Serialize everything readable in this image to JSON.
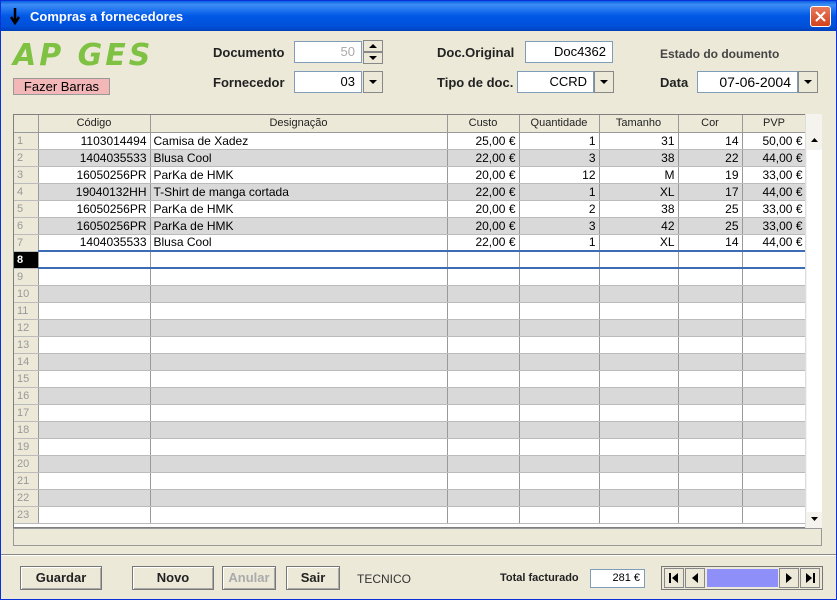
{
  "window": {
    "title": "Compras a fornecedores"
  },
  "header": {
    "logo_text": "AP GES",
    "bars_button": "Fazer Barras",
    "documento_label": "Documento",
    "documento_value": "50",
    "fornecedor_label": "Fornecedor",
    "fornecedor_value": "03",
    "doc_original_label": "Doc.Original",
    "doc_original_value": "Doc4362",
    "tipo_doc_label": "Tipo de doc.",
    "tipo_doc_value": "CCRD",
    "estado_label": "Estado do doumento",
    "data_label": "Data",
    "data_value": "07-06-2004"
  },
  "grid": {
    "columns": [
      "Código",
      "Designação",
      "Custo",
      "Quantidade",
      "Tamanho",
      "Cor",
      "PVP"
    ],
    "rows": [
      [
        "1103014494",
        "Camisa de Xadez",
        "25,00 €",
        "1",
        "31",
        "14",
        "50,00 €"
      ],
      [
        "1404035533",
        "Blusa Cool",
        "22,00 €",
        "3",
        "38",
        "22",
        "44,00 €"
      ],
      [
        "16050256PR",
        "ParKa de HMK",
        "20,00 €",
        "12",
        "M",
        "19",
        "33,00 €"
      ],
      [
        "19040132HH",
        "T-Shirt de manga cortada",
        "22,00 €",
        "1",
        "XL",
        "17",
        "44,00 €"
      ],
      [
        "16050256PR",
        "ParKa de HMK",
        "20,00 €",
        "2",
        "38",
        "25",
        "33,00 €"
      ],
      [
        "16050256PR",
        "ParKa de HMK",
        "20,00 €",
        "3",
        "42",
        "25",
        "33,00 €"
      ],
      [
        "1404035533",
        "Blusa Cool",
        "22,00 €",
        "1",
        "XL",
        "14",
        "44,00 €"
      ]
    ],
    "row_numbers": [
      "1",
      "2",
      "3",
      "4",
      "5",
      "6",
      "7",
      "8",
      "9",
      "10",
      "11",
      "12",
      "13",
      "14",
      "15",
      "16",
      "17",
      "18",
      "19",
      "20",
      "21",
      "22",
      "23"
    ],
    "active_row": "8"
  },
  "footer": {
    "guardar": "Guardar",
    "novo": "Novo",
    "anular": "Anular",
    "sair": "Sair",
    "user": "TECNICO",
    "total_label": "Total facturado",
    "total_value": "281 €"
  },
  "colors": {
    "title_bar": "#0058e6",
    "logo_green": "#7fc243",
    "bars_button_bg": "#f4b7b7",
    "selected_row_border": "#3c6cb4",
    "nav_track": "#8f8ff9"
  }
}
